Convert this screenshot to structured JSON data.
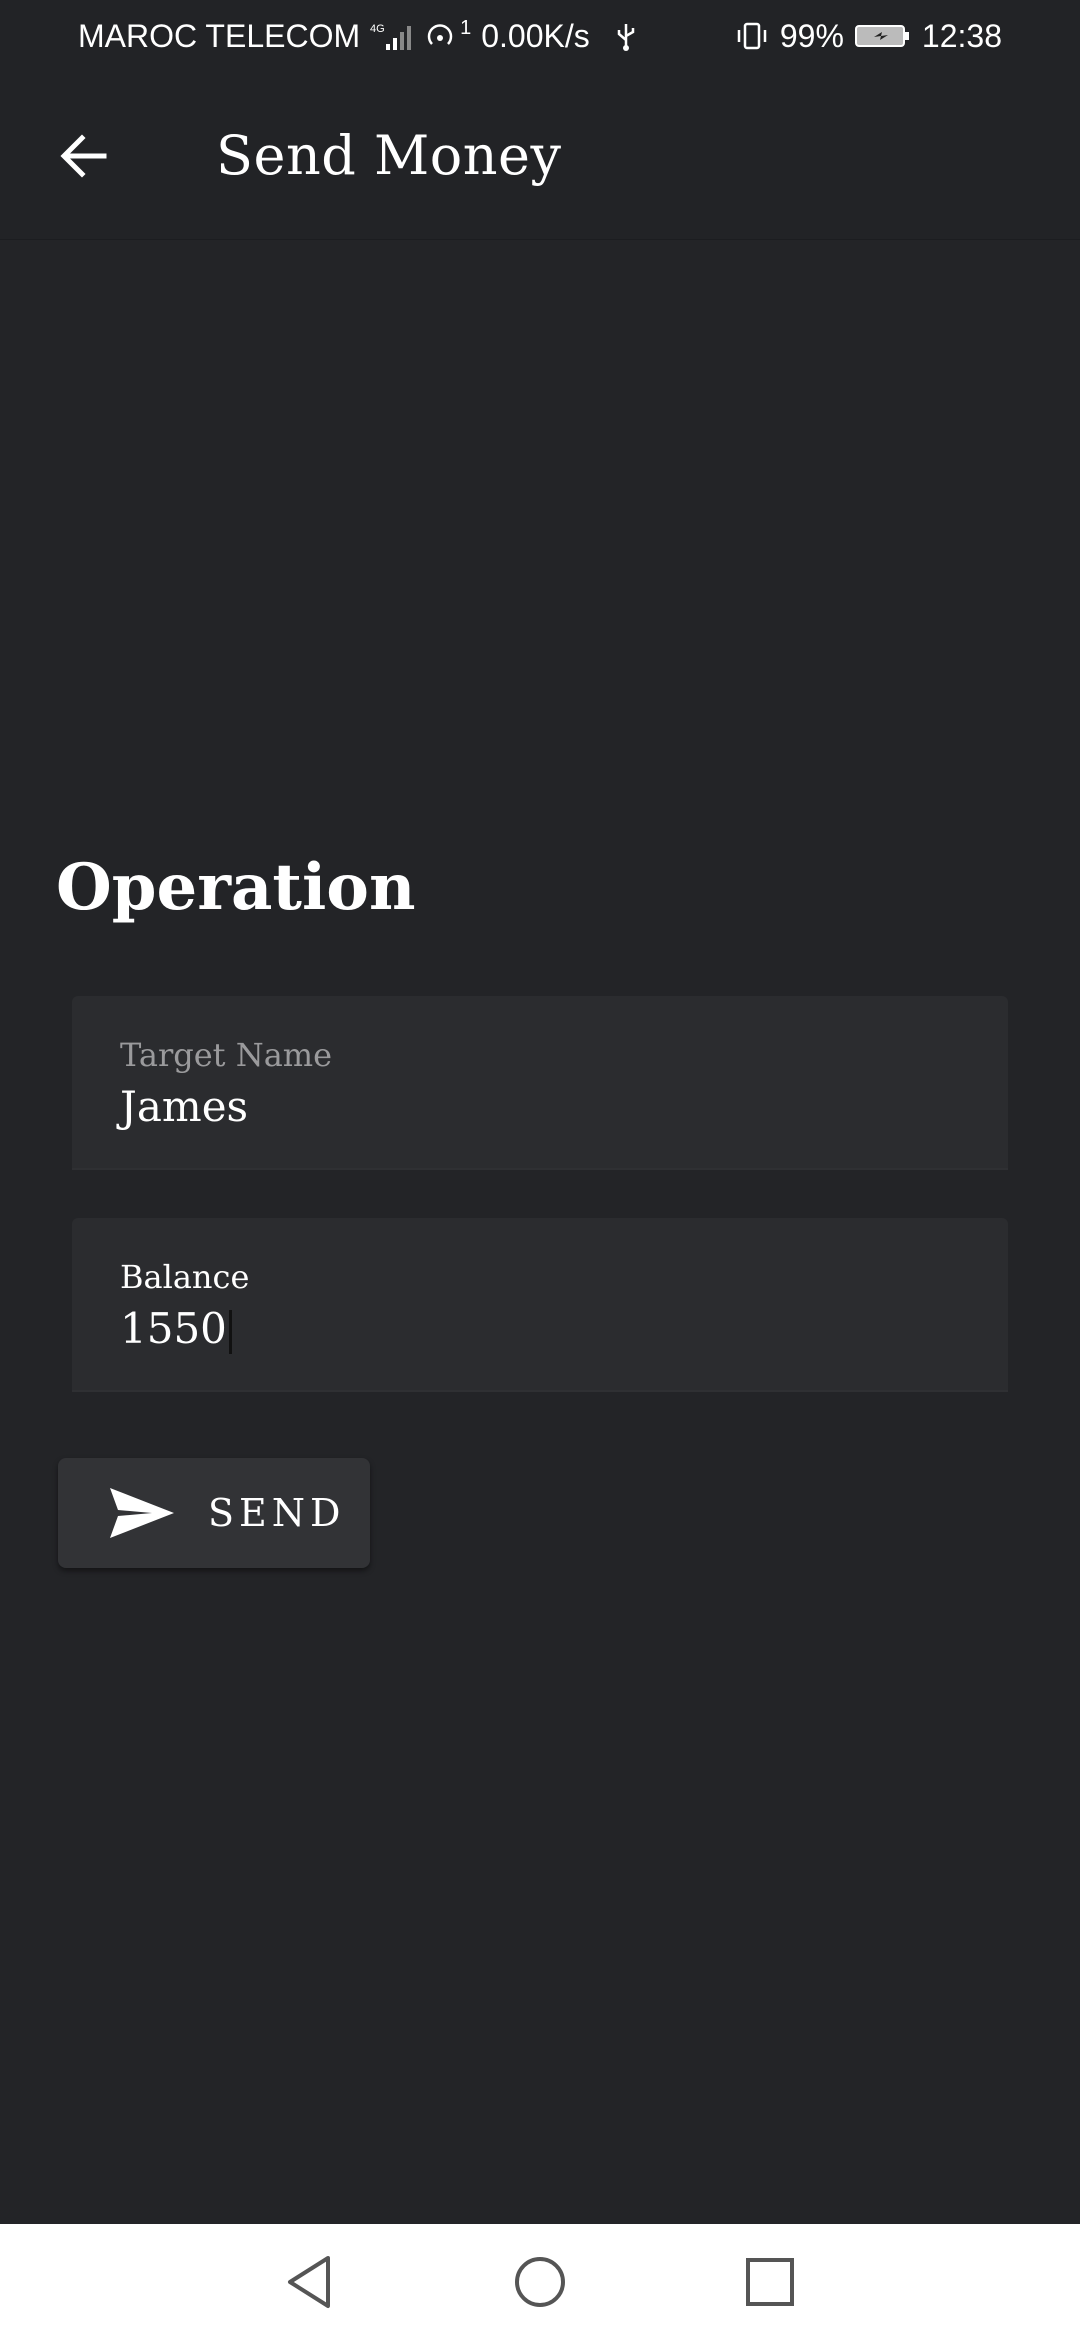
{
  "status_bar": {
    "carrier": "MAROC TELECOM",
    "network_type": "4G",
    "hotspot_count": "1",
    "speed": "0.00K/s",
    "battery": "99%",
    "time": "12:38"
  },
  "app_bar": {
    "title": "Send Money",
    "back_icon": "arrow-left-icon"
  },
  "section": {
    "title": "Operation"
  },
  "form": {
    "target_name": {
      "label": "Target Name",
      "value": "James"
    },
    "balance": {
      "label": "Balance",
      "value": "1550"
    }
  },
  "send_button": {
    "label": "SEND",
    "icon": "send-icon"
  },
  "nav": {
    "back": "nav-back-icon",
    "home": "nav-home-icon",
    "recents": "nav-recents-icon"
  },
  "colors": {
    "background": "#232427",
    "field_bg": "#2b2c2f",
    "button_bg": "#323336",
    "nav_bg": "#ffffff"
  }
}
